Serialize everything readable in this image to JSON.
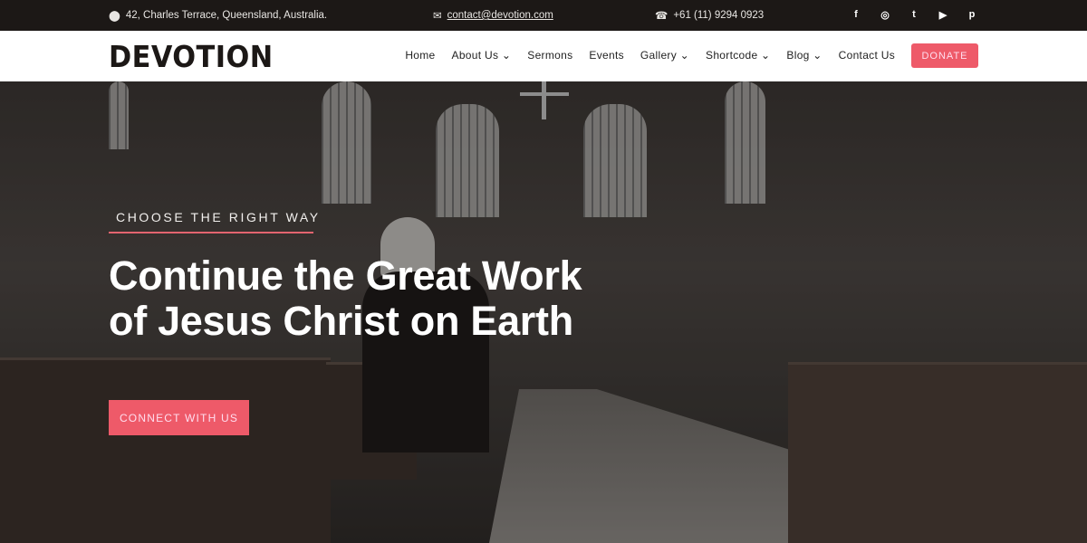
{
  "topbar": {
    "address": "42, Charles Terrace, Queensland, Australia.",
    "email": "contact@devotion.com",
    "phone": "+61 (11) 9294 0923",
    "social": [
      {
        "name": "facebook-icon",
        "glyph": "f"
      },
      {
        "name": "instagram-icon",
        "glyph": "◎"
      },
      {
        "name": "twitter-icon",
        "glyph": "t"
      },
      {
        "name": "youtube-icon",
        "glyph": "▶"
      },
      {
        "name": "pinterest-icon",
        "glyph": "p"
      }
    ]
  },
  "nav": {
    "logo": "DEVOTION",
    "items": [
      "Home",
      "About Us ⌄",
      "Sermons",
      "Events",
      "Gallery ⌄",
      "Shortcode ⌄",
      "Blog ⌄",
      "Contact Us"
    ],
    "donate": "DONATE"
  },
  "hero": {
    "eyebrow": "CHOOSE THE RIGHT WAY",
    "title_line1": "Continue the Great Work",
    "title_line2": "of Jesus Christ on Earth",
    "cta": "CONNECT WITH US"
  },
  "colors": {
    "accent": "#ee5a69",
    "topbar": "#1c1816"
  }
}
